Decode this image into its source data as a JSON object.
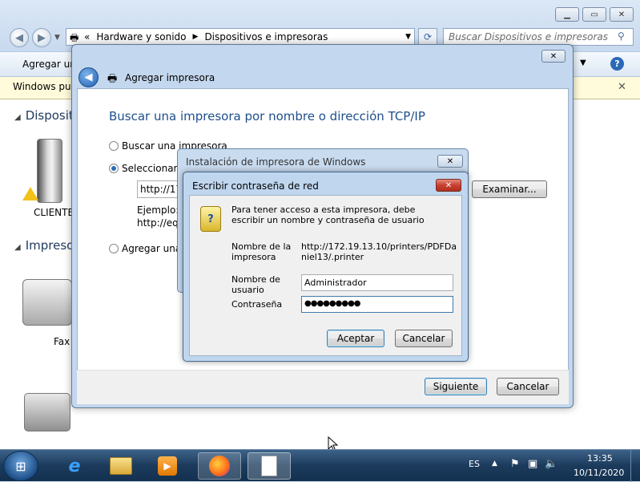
{
  "explorer": {
    "breadcrumb": [
      "Hardware y sonido",
      "Dispositivos e impresoras"
    ],
    "breadcrumb_prefix": "«",
    "search_placeholder": "Buscar Dispositivos e impresoras",
    "toolbar_label": "Agregar un",
    "infobar_text": "Windows pue",
    "group_devices": "Dispositi",
    "group_printers": "Impresor",
    "device_client_label": "CLIENTE",
    "device_fax_label": "Fax"
  },
  "wizard": {
    "title": "Agregar impresora",
    "heading": "Buscar una impresora por nombre o dirección TCP/IP",
    "option_search": "Buscar una impresora",
    "option_select": "Seleccionar u",
    "url_value": "http://17",
    "browse_button": "Examinar...",
    "example_line1": "Ejemplo: \\",
    "example_line2": "http://equ",
    "option_add": "Agregar una i",
    "next_button": "Siguiente",
    "cancel_button": "Cancelar"
  },
  "install_dialog": {
    "title": "Instalación de impresora de Windows"
  },
  "password_dialog": {
    "title": "Escribir contraseña de red",
    "message": "Para tener acceso a esta impresora, debe escribir un nombre y contraseña de usuario",
    "printer_name_label": "Nombre de la impresora",
    "printer_name_value": "http://172.19.13.10/printers/PDFDaniel13/.printer",
    "username_label": "Nombre de usuario",
    "username_value": "Administrador",
    "password_label": "Contraseña",
    "password_value": "●●●●●●●●●",
    "accept_button": "Aceptar",
    "cancel_button": "Cancelar"
  },
  "taskbar": {
    "language": "ES",
    "time": "13:35",
    "date": "10/11/2020"
  },
  "colors": {
    "heading_blue": "#1e4f8c",
    "taskbar": "#1c3b5c",
    "close_red": "#c8402f"
  }
}
